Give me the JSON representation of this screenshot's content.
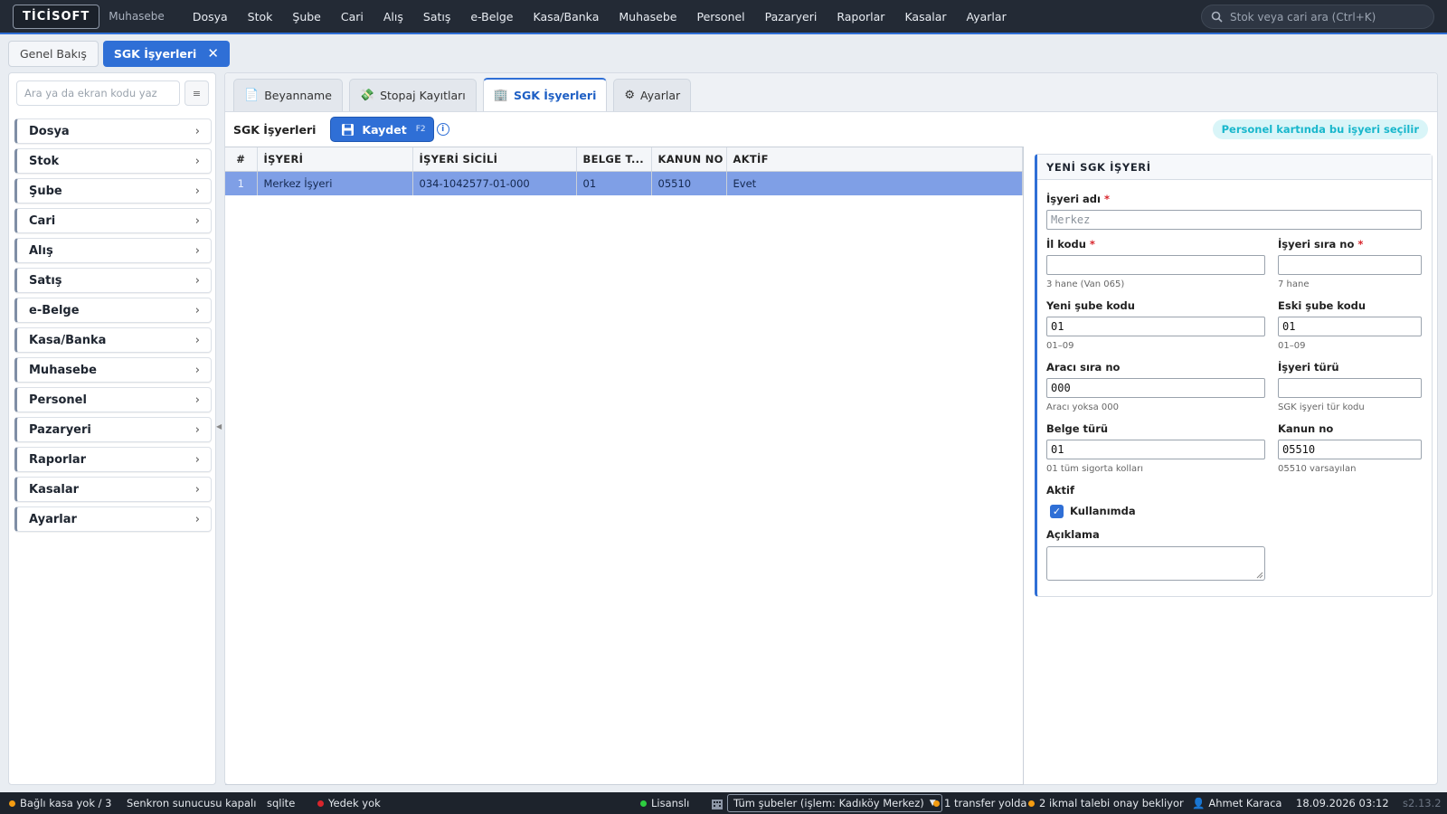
{
  "app": {
    "logo": "TİCİSOFT",
    "subtitle": "Muhasebe"
  },
  "nav": [
    "Dosya",
    "Stok",
    "Şube",
    "Cari",
    "Alış",
    "Satış",
    "e-Belge",
    "Kasa/Banka",
    "Muhasebe",
    "Personel",
    "Pazaryeri",
    "Raporlar",
    "Kasalar",
    "Ayarlar"
  ],
  "top_search": {
    "placeholder": "Stok veya cari ara (Ctrl+K)"
  },
  "page_tabs": [
    {
      "label": "Genel Bakış"
    },
    {
      "label": "SGK İşyerleri",
      "close": "✕"
    }
  ],
  "sidebar": {
    "search_placeholder": "Ara ya da ekran kodu yaz",
    "items": [
      "Dosya",
      "Stok",
      "Şube",
      "Cari",
      "Alış",
      "Satış",
      "e-Belge",
      "Kasa/Banka",
      "Muhasebe",
      "Personel",
      "Pazaryeri",
      "Raporlar",
      "Kasalar",
      "Ayarlar"
    ]
  },
  "main_tabs": [
    {
      "label": "Beyanname",
      "icon": "📄"
    },
    {
      "label": "Stopaj Kayıtları",
      "icon": "💸"
    },
    {
      "label": "SGK İşyerleri",
      "icon": "🏢"
    },
    {
      "label": "Ayarlar",
      "icon": "⚙"
    }
  ],
  "toolbar": {
    "title": "SGK İşyerleri",
    "save_label": "Kaydet",
    "save_shortcut": "F2",
    "hint": "Personel kartında bu işyeri seçilir"
  },
  "table": {
    "columns": [
      "#",
      "İŞYERİ",
      "İŞYERİ SİCİLİ",
      "BELGE T...",
      "KANUN NO",
      "AKTİF"
    ],
    "rows": [
      [
        "1",
        "Merkez İşyeri",
        "034-1042577-01-000",
        "01",
        "05510",
        "Evet"
      ]
    ]
  },
  "form": {
    "title": "YENİ SGK İŞYERİ",
    "isyeri_adi": {
      "label": "İşyeri adı",
      "placeholder": "Merkez",
      "value": ""
    },
    "il_kodu": {
      "label": "İl kodu",
      "value": "",
      "help": "3 hane (Van 065)"
    },
    "isyeri_sira_no": {
      "label": "İşyeri sıra no",
      "value": "",
      "help": "7 hane"
    },
    "yeni_sube_kodu": {
      "label": "Yeni şube kodu",
      "value": "01",
      "help": "01–09"
    },
    "eski_sube_kodu": {
      "label": "Eski şube kodu",
      "value": "01",
      "help": "01–09"
    },
    "araci_sira_no": {
      "label": "Aracı sıra no",
      "value": "000",
      "help": "Aracı yoksa 000"
    },
    "isyeri_turu": {
      "label": "İşyeri türü",
      "value": "",
      "help": "SGK işyeri tür kodu"
    },
    "belge_turu": {
      "label": "Belge türü",
      "value": "01",
      "help": "01 tüm sigorta kolları"
    },
    "kanun_no": {
      "label": "Kanun no",
      "value": "05510",
      "help": "05510 varsayılan"
    },
    "aktif": {
      "label": "Aktif",
      "checkbox_label": "Kullanımda",
      "checked": true
    },
    "aciklama": {
      "label": "Açıklama"
    },
    "required_mark": "*"
  },
  "status": {
    "kasa": "Bağlı kasa yok / 3",
    "sync": "Senkron sunucusu kapalı",
    "db": "sqlite",
    "backup": "Yedek yok",
    "license": "Lisanslı",
    "branch": "Tüm şubeler (işlem: Kadıköy Merkez)",
    "transfer": "1 transfer yolda",
    "ikmal": "2 ikmal talebi onay bekliyor",
    "user": "Ahmet Karaca",
    "datetime": "18.09.2026 03:12",
    "version": "s2.13.2"
  },
  "colors": {
    "accent": "#2f6fd6",
    "topbar": "#232a35",
    "selected_row": "#7f9fe6",
    "hint": "#19b7cc",
    "danger": "#d8252c",
    "ok": "#2ecc40",
    "warn": "#f39c12"
  }
}
